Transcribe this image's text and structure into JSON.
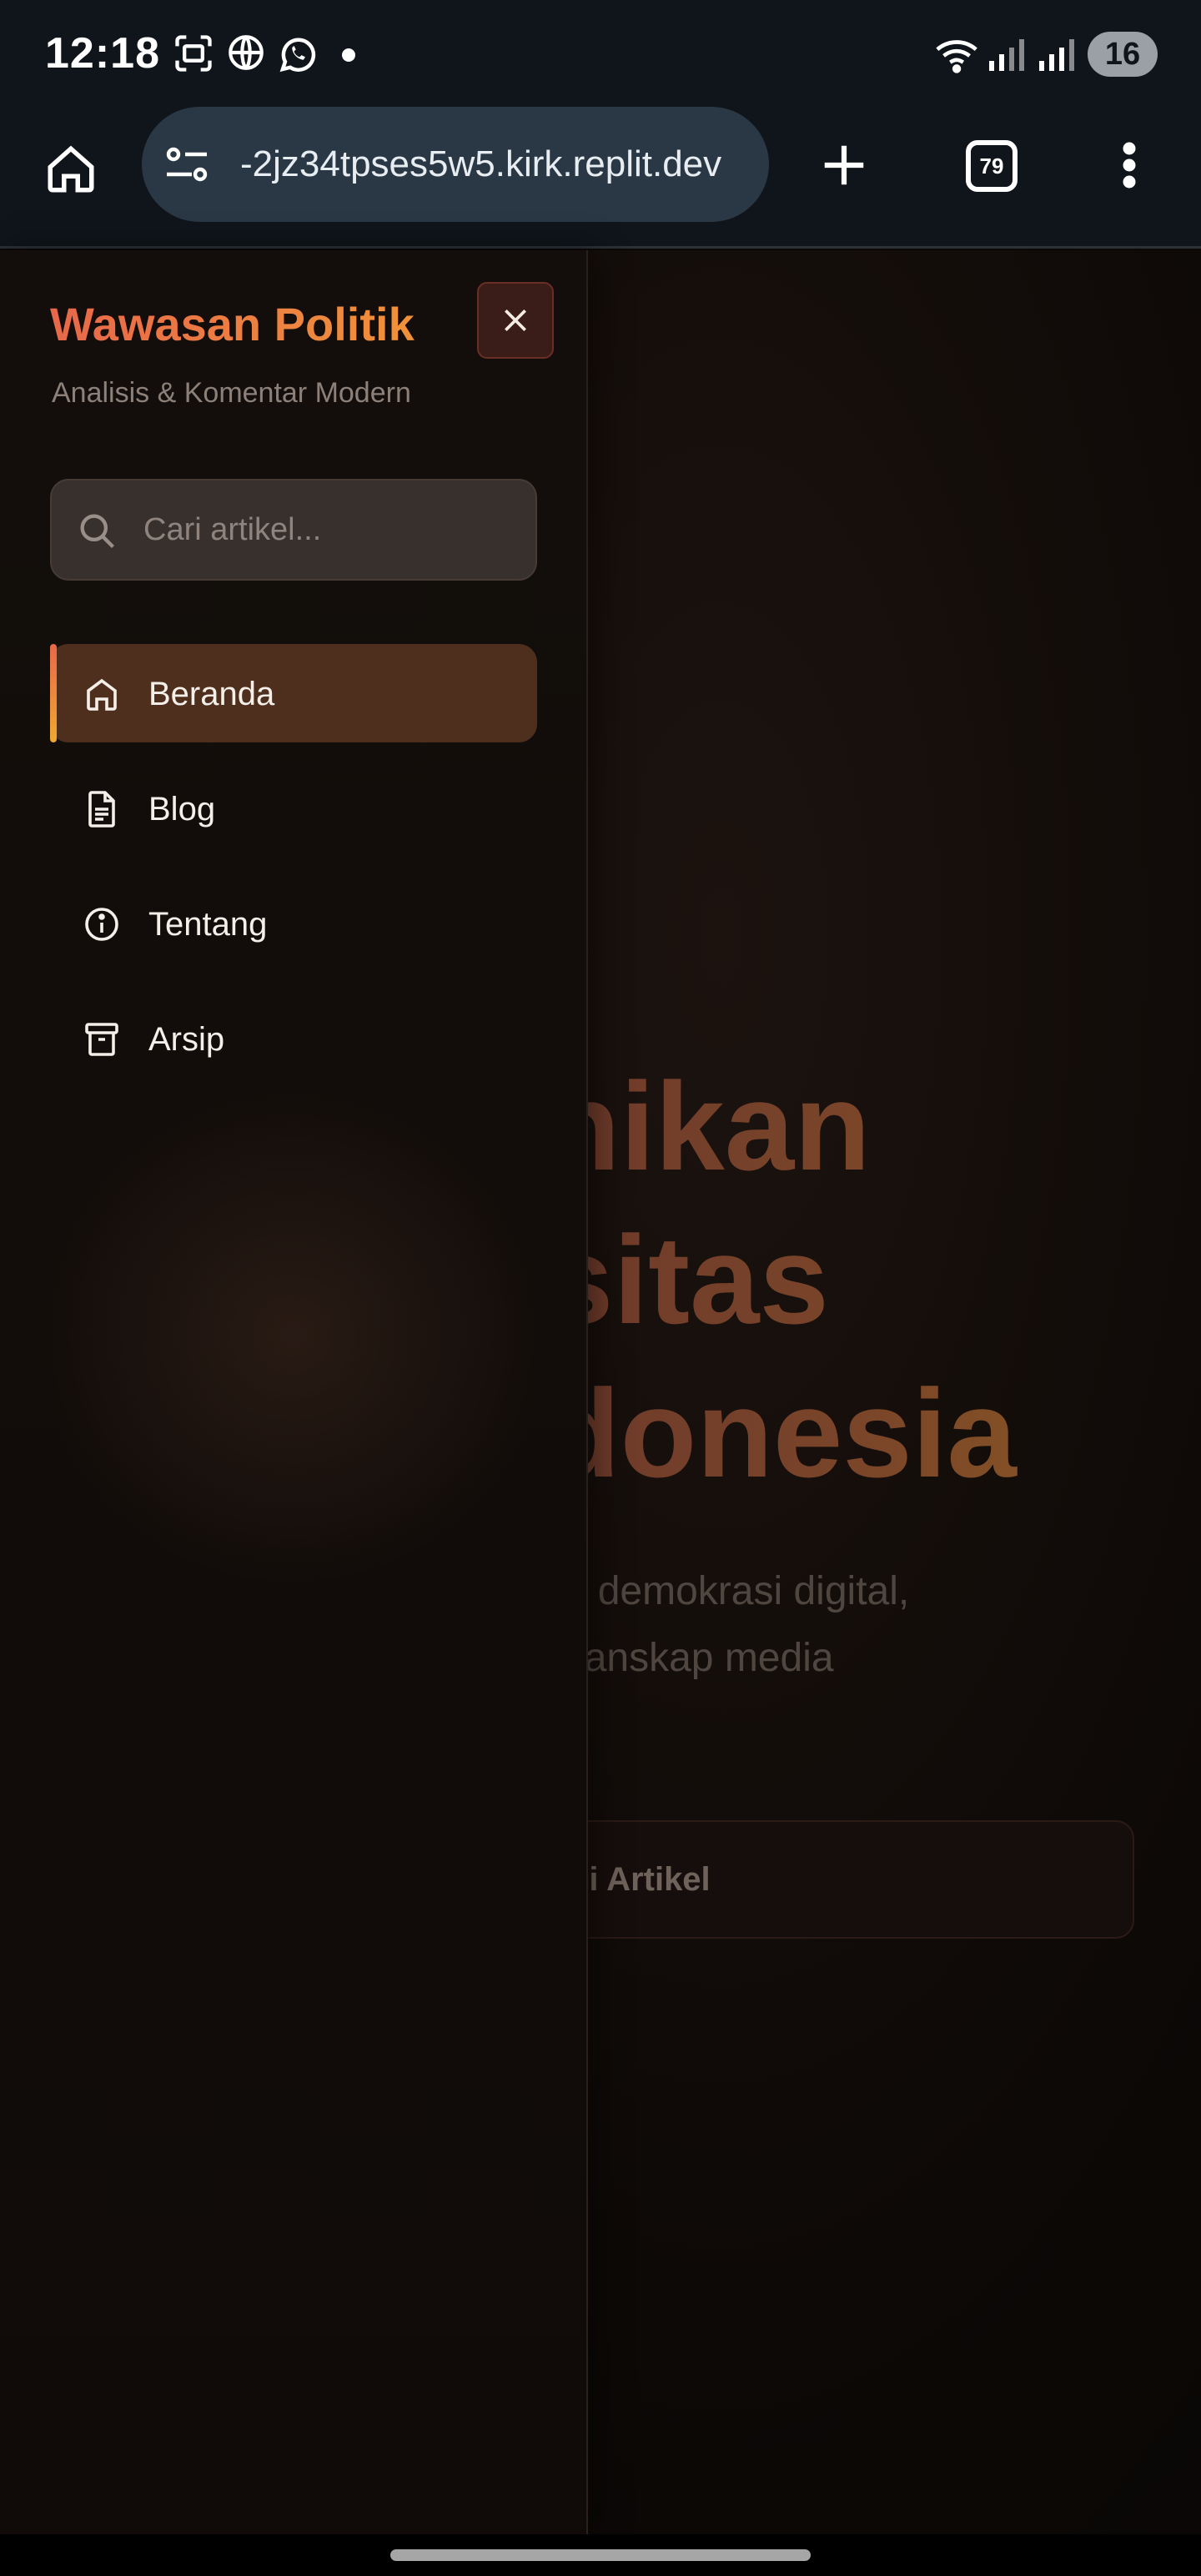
{
  "status_bar": {
    "time": "12:18",
    "battery": "16",
    "icons": [
      "screenshot-icon",
      "globe-icon",
      "whatsapp-icon",
      "wifi-icon",
      "signal-icon",
      "signal-icon"
    ]
  },
  "browser": {
    "url": "-2jz34tpses5w5.kirk.replit.dev",
    "tab_count": "79"
  },
  "drawer": {
    "brand_title": "Wawasan Politik",
    "brand_subtitle": "Analisis & Komentar Modern",
    "search_placeholder": "Cari artikel...",
    "nav_items": [
      {
        "label": "Beranda",
        "icon": "home-icon",
        "active": true
      },
      {
        "label": "Blog",
        "icon": "document-icon",
        "active": false
      },
      {
        "label": "Tentang",
        "icon": "info-icon",
        "active": false
      },
      {
        "label": "Arsip",
        "icon": "archive-icon",
        "active": false
      }
    ]
  },
  "background_page": {
    "hero_lines": [
      "nikan",
      "sitas",
      "donesia"
    ],
    "hero_subtitle_lines": [
      "ng demokrasi digital,",
      "n lanskap media"
    ],
    "cta_label": "ni Artikel"
  },
  "colors": {
    "accent_start": "#e8684a",
    "accent_end": "#f0923a",
    "active_item_bg": "#4e2f1e",
    "close_button_bg": "#3a1d18"
  }
}
